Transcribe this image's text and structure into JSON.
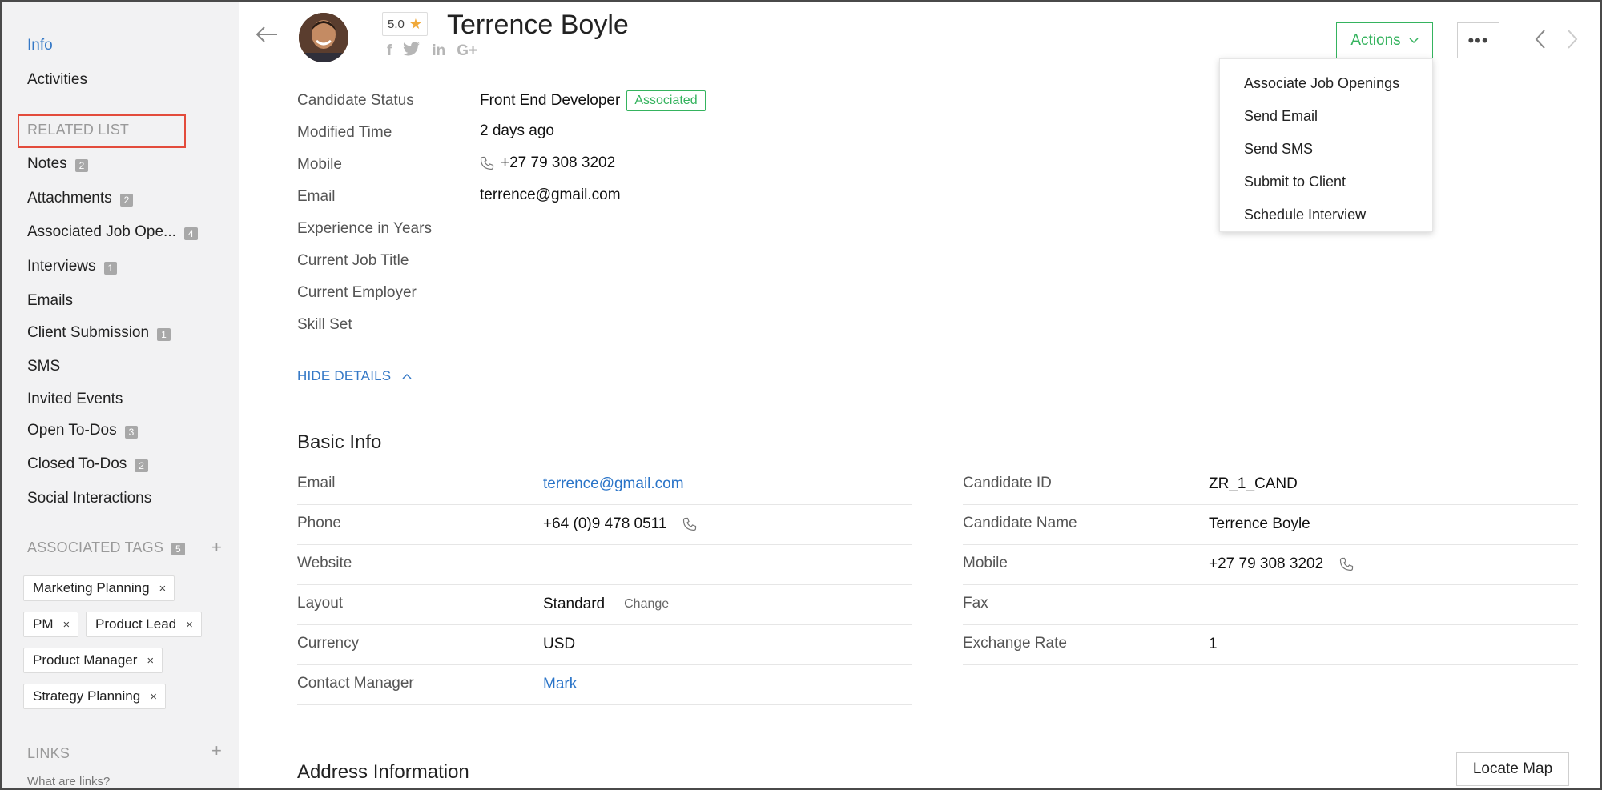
{
  "sidebar": {
    "info": "Info",
    "activities": "Activities",
    "related_list_title": "RELATED LIST",
    "related_items": [
      {
        "label": "Notes",
        "count": "2"
      },
      {
        "label": "Attachments",
        "count": "2"
      },
      {
        "label": "Associated Job Ope...",
        "count": "4"
      },
      {
        "label": "Interviews",
        "count": "1"
      },
      {
        "label": "Emails",
        "count": ""
      },
      {
        "label": "Client Submission",
        "count": "1"
      },
      {
        "label": "SMS",
        "count": ""
      },
      {
        "label": "Invited Events",
        "count": ""
      },
      {
        "label": "Open To-Dos",
        "count": "3"
      },
      {
        "label": "Closed To-Dos",
        "count": "2"
      },
      {
        "label": "Social Interactions",
        "count": ""
      }
    ],
    "associated_tags_title": "ASSOCIATED TAGS",
    "associated_tags_count": "5",
    "plus": "+",
    "tags": [
      "Marketing Planning",
      "PM",
      "Product Lead",
      "Product Manager",
      "Strategy Planning"
    ],
    "tag_remove": "×",
    "links_title": "LINKS",
    "links_help": "What are links?"
  },
  "header": {
    "rating": "5.0",
    "star": "★",
    "candidate_name": "Terrence Boyle",
    "social": [
      "f",
      "t",
      "in",
      "G+"
    ],
    "actions_label": "Actions",
    "more_label": "•••"
  },
  "actions_menu": [
    "Associate Job Openings",
    "Send Email",
    "Send SMS",
    "Submit to Client",
    "Schedule Interview"
  ],
  "details": {
    "labels": [
      "Candidate Status",
      "Modified Time",
      "Mobile",
      "Email",
      "Experience in Years",
      "Current Job Title",
      "Current Employer",
      "Skill Set"
    ],
    "status_value": "Front End Developer",
    "status_badge": "Associated",
    "modified_time": "2 days ago",
    "mobile": "+27 79 308 3202",
    "email": "terrence@gmail.com",
    "hide_details": "HIDE DETAILS"
  },
  "basic_info": {
    "title": "Basic Info",
    "left": [
      {
        "label": "Email",
        "value": "terrence@gmail.com"
      },
      {
        "label": "Phone",
        "value": "+64 (0)9 478 0511"
      },
      {
        "label": "Website",
        "value": ""
      },
      {
        "label": "Layout",
        "value": "Standard",
        "extra": "Change"
      },
      {
        "label": "Currency",
        "value": "USD"
      },
      {
        "label": "Contact Manager",
        "value": "Mark"
      }
    ],
    "right": [
      {
        "label": "Candidate ID",
        "value": "ZR_1_CAND"
      },
      {
        "label": "Candidate Name",
        "value": "Terrence Boyle"
      },
      {
        "label": "Mobile",
        "value": "+27 79 308 3202"
      },
      {
        "label": "Fax",
        "value": ""
      },
      {
        "label": "Exchange Rate",
        "value": "1"
      }
    ]
  },
  "address": {
    "title": "Address Information",
    "locate_map": "Locate Map"
  },
  "colors": {
    "accent_blue": "#3478c6",
    "green": "#35b35e",
    "highlight_red": "#e34b3b"
  }
}
